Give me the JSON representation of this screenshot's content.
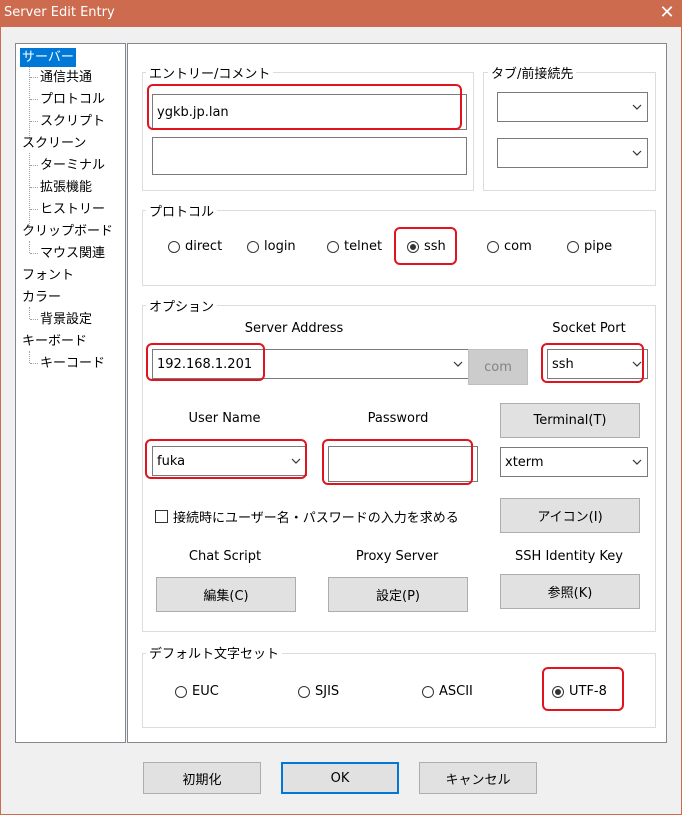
{
  "window": {
    "title": "Server Edit Entry",
    "close_label": "✕"
  },
  "tree": {
    "items": [
      {
        "label": "サーバー",
        "selected": true
      },
      {
        "label": "通信共通"
      },
      {
        "label": "プロトコル"
      },
      {
        "label": "スクリプト"
      },
      {
        "label": "スクリーン"
      },
      {
        "label": "ターミナル"
      },
      {
        "label": "拡張機能"
      },
      {
        "label": "ヒストリー"
      },
      {
        "label": "クリップボード"
      },
      {
        "label": "マウス関連"
      },
      {
        "label": "フォント"
      },
      {
        "label": "カラー"
      },
      {
        "label": "背景設定"
      },
      {
        "label": "キーボード"
      },
      {
        "label": "キーコード"
      }
    ]
  },
  "entry": {
    "group_label": "エントリー/コメント",
    "entry_value": "ygkb.jp.lan",
    "comment_value": ""
  },
  "tab": {
    "group_label": "タブ/前接続先",
    "combo1_value": "",
    "combo2_value": ""
  },
  "protocol": {
    "group_label": "プロトコル",
    "options": [
      "direct",
      "login",
      "telnet",
      "ssh",
      "com",
      "pipe"
    ],
    "selected": "ssh"
  },
  "options": {
    "group_label": "オプション",
    "server_address_label": "Server Address",
    "server_address_value": "192.168.1.201",
    "com_button": "com",
    "socket_port_label": "Socket Port",
    "socket_port_value": "ssh",
    "user_name_label": "User Name",
    "user_name_value": "fuka",
    "password_label": "Password",
    "password_value": "",
    "terminal_button": "Terminal(T)",
    "terminal_value": "xterm",
    "prompt_checkbox_label": "接続時にユーザー名・パスワードの入力を求める",
    "prompt_checked": false,
    "icon_button": "アイコン(I)",
    "chat_script_label": "Chat Script",
    "chat_script_button": "編集(C)",
    "proxy_server_label": "Proxy Server",
    "proxy_server_button": "設定(P)",
    "ssh_key_label": "SSH Identity Key",
    "ssh_key_button": "参照(K)"
  },
  "charset": {
    "group_label": "デフォルト文字セット",
    "options": [
      "EUC",
      "SJIS",
      "ASCII",
      "UTF-8"
    ],
    "selected": "UTF-8"
  },
  "footer": {
    "reset_button": "初期化",
    "ok_button": "OK",
    "cancel_button": "キャンセル"
  },
  "colors": {
    "titlebar": "#cd6b4f",
    "selection": "#0078d7",
    "highlight": "#e0141e"
  },
  "icons": {
    "combo_arrow": "chevron-down-icon",
    "close": "close-icon"
  }
}
